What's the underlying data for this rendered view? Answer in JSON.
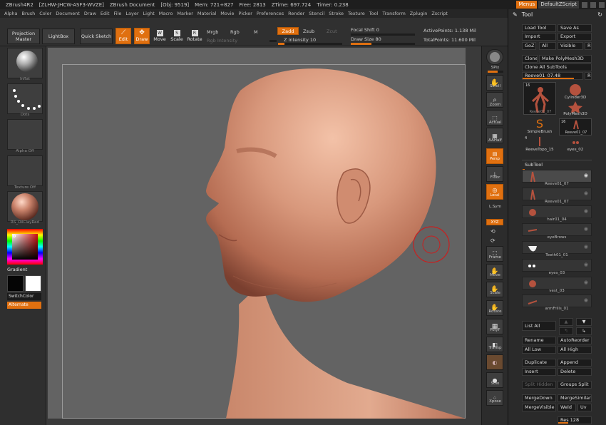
{
  "titlebar": {
    "app": "ZBrush4R2",
    "serial": "[ZLHW-JHCW-ASF3-WVZE]",
    "doc": "ZBrush Document",
    "obj": "[Obj: 9519]",
    "mem": "Mem: 721+827",
    "free": "Free: 2813",
    "ztime": "ZTime: 697.724",
    "timer": "Timer: 0.238",
    "menus_label": "Menus",
    "script_label": "DefaultZScript"
  },
  "menubar": {
    "items": [
      "Alpha",
      "Brush",
      "Color",
      "Document",
      "Draw",
      "Edit",
      "File",
      "Layer",
      "Light",
      "Macro",
      "Marker",
      "Material",
      "Movie",
      "Picker",
      "Preferences",
      "Render",
      "Stencil",
      "Stroke",
      "Texture",
      "Tool",
      "Transform",
      "Zplugin",
      "Zscript"
    ]
  },
  "shelf": {
    "projection_master": "Projection Master",
    "lightbox": "LightBox",
    "quick_sketch": "Quick Sketch",
    "edit": "Edit",
    "draw": "Draw",
    "move": "Move",
    "scale": "Scale",
    "rotate": "Rotate",
    "mrgb": "Mrgb",
    "rgb": "Rgb",
    "m": "M",
    "rgb_intensity": "Rgb Intensity",
    "zadd": "Zadd",
    "zsub": "Zsub",
    "zcut": "Zcut",
    "z_intensity": "Z Intensity 10",
    "focal_shift": "Focal Shift 0",
    "draw_size": "Draw Size 80",
    "active_points": "ActivePoints: 1.138 Mil",
    "total_points": "TotalPoints: 11.600 Mil",
    "z_intensity_level": 0.1,
    "draw_size_level": 0.32
  },
  "lefttray": {
    "inflat": "Inflat",
    "dots": "Dots",
    "alpha_off": "Alpha Off",
    "texture_off": "Texture Off",
    "material": "RS_OilClayRed",
    "gradient": "Gradient",
    "switch_color": "SwitchColor",
    "alternate": "Alternate"
  },
  "rightstrip": {
    "items": [
      "SPix",
      "Scroll",
      "Zoom",
      "Actual",
      "AAHalf",
      "Persp",
      "Floor",
      "Local",
      "L.Sym",
      "XYZ",
      "Frame",
      "Move",
      "Scale",
      "Rotate",
      "PolyF",
      "Transp",
      "Ghost",
      "Solo",
      "Xpose"
    ]
  },
  "tool": {
    "title": "Tool",
    "load_tool": "Load Tool",
    "save_as": "Save As",
    "import": "Import",
    "export": "Export",
    "goz": "GoZ",
    "all": "All",
    "visible": "Visible",
    "r": "R",
    "clone": "Clone",
    "make_polymesh": "Make PolyMesh3D",
    "clone_all_subtools": "Clone All SubTools",
    "current_tool": "Reeve01_07.48",
    "thumbs": [
      "Reeve01_07",
      "Cylinder3D",
      "PolyMesh3D",
      "SimpleBrush",
      "Reeve01_07",
      "ReeveTopo_15",
      "eyes_02"
    ],
    "thumb_counts": [
      "16",
      "16",
      "4"
    ],
    "subtool_title": "SubTool",
    "subtools": [
      "Reeve01_07",
      "Reeve01_07",
      "hair01_04",
      "eyeBrows",
      "Teeth01_01",
      "eyes_03",
      "vest_03",
      "armFrills_01"
    ],
    "list_all": "List All",
    "rename": "Rename",
    "autoreorder": "AutoReorder",
    "all_low": "All Low",
    "all_high": "All High",
    "duplicate": "Duplicate",
    "append": "Append",
    "insert": "Insert",
    "delete": "Delete",
    "split_hidden": "Split Hidden",
    "groups_split": "Groups Split",
    "mergedown": "MergeDown",
    "mergesimilar": "MergeSimilar",
    "mergevisible": "MergeVisible",
    "weld": "Weld",
    "uv": "Uv",
    "res_label": "Res 128"
  }
}
